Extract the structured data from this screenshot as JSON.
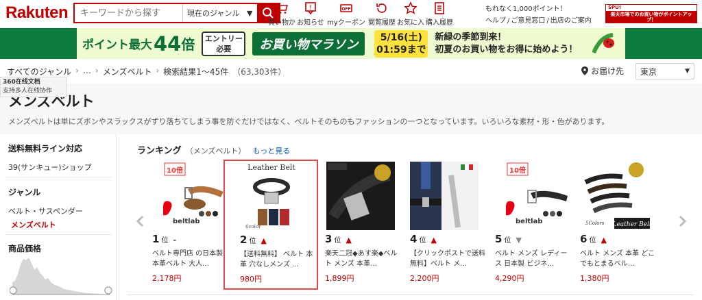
{
  "header": {
    "logo": "Rakuten",
    "search_placeholder": "キーワードから探す",
    "genre_select": "現在のジャンル",
    "icons": [
      {
        "name": "cart-icon",
        "label": "買い物かご"
      },
      {
        "name": "bell-icon",
        "label": "お知らせ"
      },
      {
        "name": "coupon-icon",
        "label": "myクーポン"
      },
      {
        "name": "history-icon",
        "label": "閲覧履歴"
      },
      {
        "name": "star-icon",
        "label": "お気に入り"
      },
      {
        "name": "receipt-icon",
        "label": "購入履歴"
      }
    ],
    "promo_text": "もれなく1,000ポイント！",
    "links": [
      "ヘルプ",
      "/",
      "ご意見窓口",
      "/",
      "出店のご案内"
    ],
    "spu_top": "SPU!",
    "spu_bottom": "楽天市場でのお買い物がポイントアップ！"
  },
  "campaign": {
    "point_label": "ポイント最大",
    "point_value": "44",
    "point_unit": "倍",
    "entry_line1": "エントリー",
    "entry_line2": "必要",
    "marathon": "お買い物マラソン",
    "date_line1": "5/16(土)",
    "date_line2": "01:59まで",
    "msg_line1": "新緑の季節到来！",
    "msg_line2": "初夏のお買い物をお得に始めよう！"
  },
  "breadcrumb": {
    "root": "すべてのジャンル",
    "ellipsis": "…",
    "current": "メンズベルト",
    "results": "検索結果1～45件",
    "count": "（63,303件）"
  },
  "delivery": {
    "label": "お届け先",
    "region": "東京"
  },
  "tooltip": {
    "line1": "360在线文档",
    "line2": "支持多人在线协作"
  },
  "page": {
    "title": "メンズベルト",
    "description": "メンズベルトは単にズボンやスラックスがずり落ちてしまう事を防ぐだけではなく、ベルトそのものもファッションの一つとなっています。いろいろな素材・形・色があります。"
  },
  "sidebar": {
    "free_shipping_head": "送料無料ライン対応",
    "free_shipping_item": "39(サンキュー)ショップ",
    "genre_head": "ジャンル",
    "genre_parent": "ベルト・サスペンダー",
    "genre_current": "メンズベルト",
    "price_head": "商品価格"
  },
  "ranking": {
    "title": "ランキング",
    "subtitle": "（メンズベルト）",
    "more": "もっと見る",
    "rank_suffix": "位",
    "items": [
      {
        "rank": "1",
        "trend": "-",
        "trend_type": "flat",
        "name": "ベルト専門店 の日本製 本革ベルト 大人…",
        "price": "2,178円"
      },
      {
        "rank": "2",
        "trend": "▲",
        "trend_type": "up",
        "name": "【送料無料】 ベルト 本革 穴なしメンズ …",
        "price": "980円"
      },
      {
        "rank": "3",
        "trend": "▲",
        "trend_type": "up",
        "name": "楽天二冠◆あす楽◆ベルト メンズ 本革…",
        "price": "1,899円"
      },
      {
        "rank": "4",
        "trend": "▲",
        "trend_type": "up",
        "name": "【クリックポストで送料無料】ベルト メ…",
        "price": "2,200円"
      },
      {
        "rank": "5",
        "trend": "▼",
        "trend_type": "down",
        "name": "ベルト メンズ レディース 日本製 ビジネ…",
        "price": "4,290円"
      },
      {
        "rank": "6",
        "trend": "▲",
        "trend_type": "up",
        "name": "ベルト メンズ 本革 どこでもとまるベル…",
        "price": "1,380円"
      }
    ],
    "img_badges": {
      "pct10": "10倍",
      "beltlab": "beltlab",
      "leather_belt": "Leather Belt",
      "six_color": "6color",
      "five_colors": "5Colors"
    }
  },
  "colors": {
    "brand_red": "#bf0000",
    "campaign_green": "#0d7d3f",
    "link_blue": "#0a59c4"
  }
}
